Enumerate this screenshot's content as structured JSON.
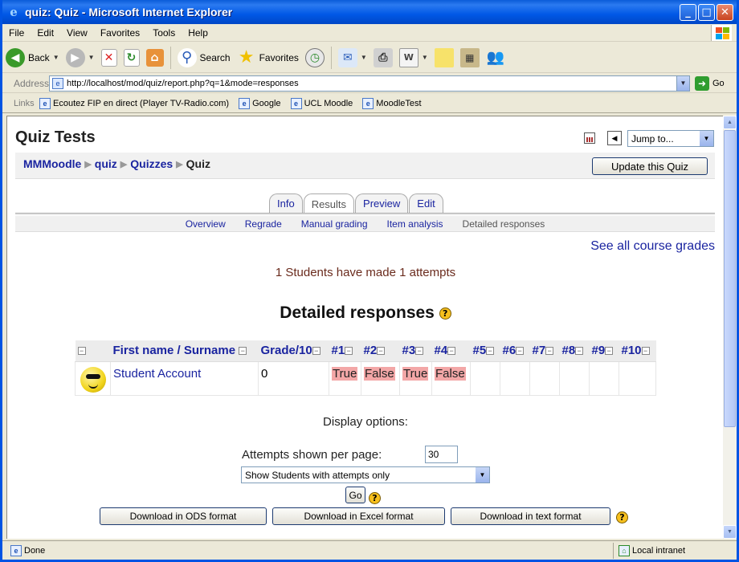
{
  "window": {
    "title": "quiz: Quiz - Microsoft Internet Explorer",
    "controls": {
      "minimize": "_",
      "maximize": "□",
      "close": "✕"
    }
  },
  "menubar": [
    "File",
    "Edit",
    "View",
    "Favorites",
    "Tools",
    "Help"
  ],
  "toolbar": {
    "back": "Back",
    "search": "Search",
    "favorites": "Favorites"
  },
  "address": {
    "label": "Address",
    "url": "http://localhost/mod/quiz/report.php?q=1&mode=responses",
    "go": "Go"
  },
  "links": {
    "label": "Links",
    "items": [
      "Ecoutez FIP en direct (Player TV-Radio.com)",
      "Google",
      "UCL Moodle",
      "MoodleTest"
    ]
  },
  "status": {
    "text": "Done",
    "zone": "Local intranet"
  },
  "page": {
    "title": "Quiz Tests",
    "jump_to": "Jump to...",
    "breadcrumb": [
      {
        "label": "MMMoodle",
        "link": true
      },
      {
        "label": "quiz",
        "link": true
      },
      {
        "label": "Quizzes",
        "link": true
      },
      {
        "label": "Quiz",
        "link": false
      }
    ],
    "update_button": "Update this Quiz",
    "tabs": [
      {
        "label": "Info",
        "active": false
      },
      {
        "label": "Results",
        "active": true
      },
      {
        "label": "Preview",
        "active": false
      },
      {
        "label": "Edit",
        "active": false
      }
    ],
    "subtabs": [
      {
        "label": "Overview",
        "active": false
      },
      {
        "label": "Regrade",
        "active": false
      },
      {
        "label": "Manual grading",
        "active": false
      },
      {
        "label": "Item analysis",
        "active": false
      },
      {
        "label": "Detailed responses",
        "active": true
      }
    ],
    "course_grades_link": "See all course grades",
    "attempts_message": "1 Students have made 1 attempts",
    "heading": "Detailed responses",
    "help": "?",
    "table": {
      "headers": [
        "",
        "First name / Surname",
        "Grade/10",
        "#1",
        "#2",
        "#3",
        "#4",
        "#5",
        "#6",
        "#7",
        "#8",
        "#9",
        "#10"
      ],
      "collapse_symbol": "−",
      "rows": [
        {
          "name": "Student Account",
          "grade": "0",
          "answers": [
            "True",
            "False",
            "True",
            "False",
            "",
            "",
            "",
            "",
            "",
            ""
          ]
        }
      ]
    },
    "display_options": {
      "heading": "Display options:",
      "per_page_label": "Attempts shown per page:",
      "per_page_value": "30",
      "show_select": "Show Students with attempts only",
      "go": "Go"
    },
    "downloads": [
      "Download in ODS format",
      "Download in Excel format",
      "Download in text format"
    ]
  },
  "colors": {
    "link": "#1a24a0",
    "wrong_answer_bg": "#f3a7a7",
    "attempts_text": "#6a2b1d",
    "titlebar": "#0058e6"
  }
}
